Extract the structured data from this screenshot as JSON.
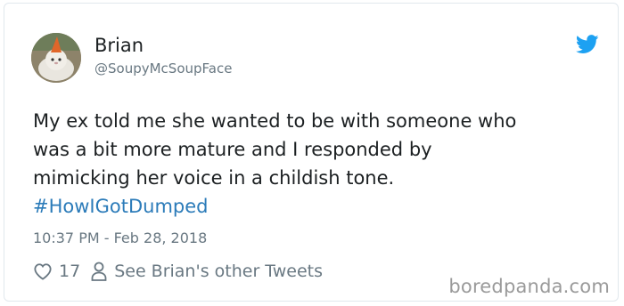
{
  "tweet": {
    "author_name": "Brian",
    "author_handle": "@SoupyMcSoupFace",
    "text": "My ex told me she wanted to be with someone who\nwas a bit more mature and I responded by\nmimicking her voice in a childish tone.",
    "hashtag": "#HowIGotDumped",
    "timestamp": "10:37 PM - Feb 28, 2018",
    "like_count": "17",
    "other_tweets_link": "See Brian's other Tweets"
  },
  "icons": {
    "brand": "twitter-bird-icon",
    "like": "heart-icon",
    "profile": "person-icon"
  },
  "colors": {
    "twitter_blue": "#1da1f2",
    "hashtag_blue": "#2b7bb9",
    "muted_gray": "#697882",
    "border": "#e1e8ed"
  },
  "watermark": "boredpanda.com"
}
